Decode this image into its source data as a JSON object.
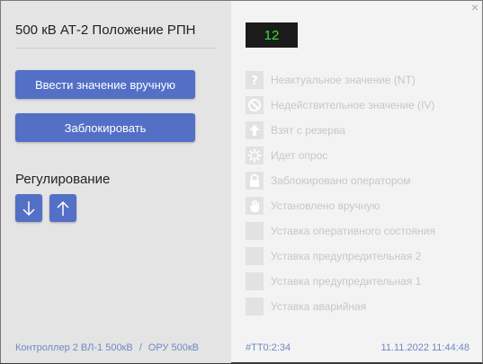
{
  "dialog": {
    "title": "500 кВ АТ-2 Положение РПН",
    "value": "12",
    "close_label": "×"
  },
  "actions": {
    "manual_entry_label": "Ввести значение вручную",
    "block_label": "Заблокировать"
  },
  "regulation": {
    "label": "Регулирование",
    "down_icon": "arrow-down-icon",
    "up_icon": "arrow-up-icon"
  },
  "statuses": [
    {
      "label": "Неактуальное значение (NT)",
      "icon": "question-icon"
    },
    {
      "label": "Недействительное значение (IV)",
      "icon": "prohibited-icon"
    },
    {
      "label": "Взят с резерва",
      "icon": "upload-icon"
    },
    {
      "label": "Идет опрос",
      "icon": "loading-icon"
    },
    {
      "label": "Заблокировано оператором",
      "icon": "lock-icon"
    },
    {
      "label": "Установлено вручную",
      "icon": "hand-icon"
    },
    {
      "label": "Уставка оперативного состояния",
      "icon": "blank-square-icon"
    },
    {
      "label": "Уставка предупредительная 2",
      "icon": "blank-square-icon"
    },
    {
      "label": "Уставка предупредительная 1",
      "icon": "blank-square-icon"
    },
    {
      "label": "Уставка аварийная",
      "icon": "blank-square-icon"
    }
  ],
  "footer": {
    "controller": "Контроллер 2 ВЛ-1 500кВ",
    "separator": "/",
    "location": "ОРУ 500кВ",
    "tag": "#ТТ0:2:34",
    "timestamp": "11.11.2022 11:44:48"
  },
  "colors": {
    "accent": "#5470c6",
    "value_text": "#2ee62e",
    "value_bg": "#1b1b1b",
    "footer_text": "#6f89c4",
    "disabled_text": "#c7c7c7"
  }
}
